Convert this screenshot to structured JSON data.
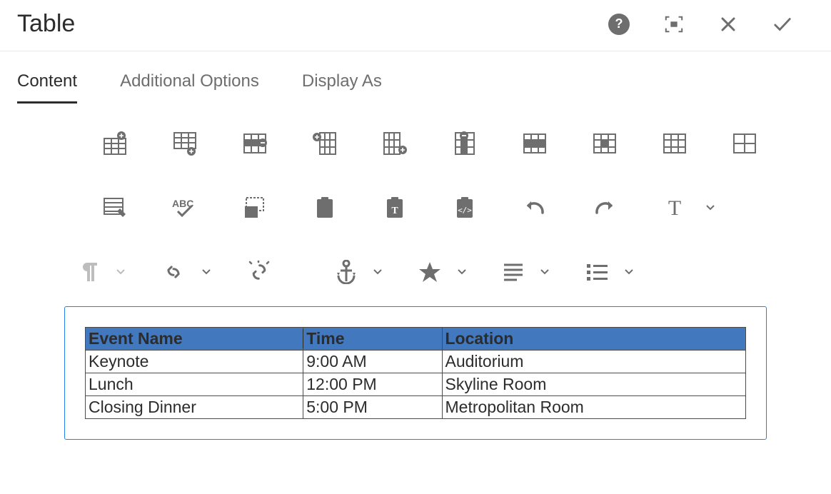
{
  "header": {
    "title": "Table"
  },
  "tabs": [
    {
      "label": "Content",
      "active": true
    },
    {
      "label": "Additional Options",
      "active": false
    },
    {
      "label": "Display As",
      "active": false
    }
  ],
  "toolbar": {
    "row1": [
      "table-insert-row-before",
      "table-insert-row-after",
      "table-delete-row",
      "table-insert-col-before",
      "table-insert-col-after",
      "table-delete-col",
      "table-cell-merge",
      "table-cell-split",
      "table-select",
      "table-other"
    ],
    "row2": [
      "cell-edit",
      "spellcheck",
      "target-mode",
      "paste",
      "paste-text",
      "paste-wordhtml",
      "undo",
      "redo"
    ],
    "row2_text_dropdown": "text-format",
    "row3": [
      {
        "name": "paraformat",
        "disabled": true,
        "caret": true
      },
      {
        "name": "link",
        "disabled": false,
        "caret": true
      },
      {
        "name": "unlink",
        "disabled": false,
        "caret": false
      },
      {
        "name": "anchor",
        "disabled": false,
        "caret": true
      },
      {
        "name": "special-char",
        "disabled": false,
        "caret": true
      },
      {
        "name": "justify",
        "disabled": false,
        "caret": true
      },
      {
        "name": "list",
        "disabled": false,
        "caret": true
      }
    ]
  },
  "table": {
    "headers": [
      "Event Name",
      "Time",
      "Location"
    ],
    "rows": [
      [
        "Keynote",
        "9:00 AM",
        "Auditorium"
      ],
      [
        "Lunch",
        "12:00 PM",
        "Skyline Room"
      ],
      [
        "Closing Dinner",
        "5:00 PM",
        "Metropolitan Room"
      ]
    ]
  }
}
